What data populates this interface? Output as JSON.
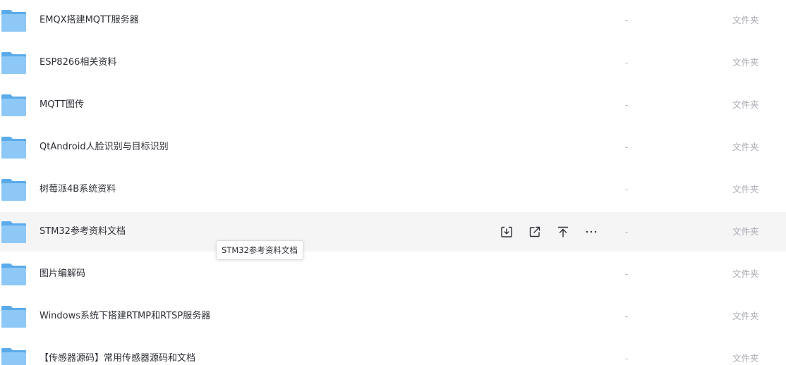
{
  "rows": [
    {
      "name": "EMQX搭建MQTT服务器",
      "size": "-",
      "type": "文件夹"
    },
    {
      "name": "ESP8266相关资料",
      "size": "-",
      "type": "文件夹"
    },
    {
      "name": "MQTT图传",
      "size": "-",
      "type": "文件夹"
    },
    {
      "name": "QtAndroid人脸识别与目标识别",
      "size": "-",
      "type": "文件夹"
    },
    {
      "name": "树莓派4B系统资料",
      "size": "-",
      "type": "文件夹"
    },
    {
      "name": "STM32参考资料文档",
      "size": "-",
      "type": "文件夹"
    },
    {
      "name": "图片编解码",
      "size": "-",
      "type": "文件夹"
    },
    {
      "name": "Windows系统下搭建RTMP和RTSP服务器",
      "size": "-",
      "type": "文件夹"
    },
    {
      "name": "【传感器源码】常用传感器源码和文档",
      "size": "-",
      "type": "文件夹"
    }
  ],
  "hover_actions": {
    "icons": [
      "download-icon",
      "share-icon",
      "move-to-top-icon",
      "more-icon"
    ],
    "more_label": "···"
  },
  "tooltip": {
    "text": "STM32参考资料文档"
  },
  "colors": {
    "folder_light": "#8ec8f6",
    "folder_dark": "#5aabeb",
    "row_hover": "#f5f5f6",
    "text": "#2c2f36",
    "muted": "#a8abb3"
  }
}
